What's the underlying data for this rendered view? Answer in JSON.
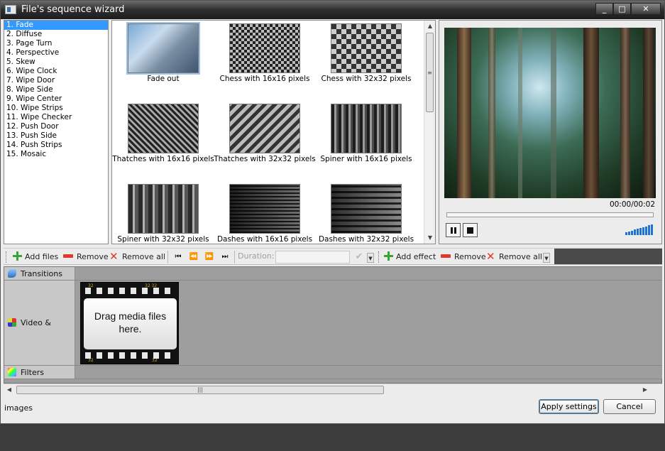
{
  "window": {
    "title": "File's sequence wizard",
    "min_icon": "_",
    "max_icon": "□",
    "close_icon": "✕"
  },
  "effects_list": [
    "1. Fade",
    "2. Diffuse",
    "3. Page Turn",
    "4. Perspective",
    "5. Skew",
    "6. Wipe Clock",
    "7. Wipe Door",
    "8. Wipe Side",
    "9. Wipe Center",
    "10. Wipe Strips",
    "11. Wipe Checker",
    "12. Push Door",
    "13. Push Side",
    "14. Push Strips",
    "15. Mosaic"
  ],
  "thumbnails": [
    "Fade out",
    "Chess with 16x16 pixels",
    "Chess with 32x32 pixels",
    "Thatches with 16x16 pixels",
    "Thatches with 32x32 pixels",
    "Spiner with 16x16 pixels",
    "Spiner with 32x32 pixels",
    "Dashes with 16x16 pixels",
    "Dashes with 32x32 pixels"
  ],
  "preview": {
    "timecode": "00:00/00:02",
    "progress": 0,
    "volume_bars": 10
  },
  "toolbar": {
    "add_files": "Add files",
    "remove": "Remove",
    "remove_all": "Remove all",
    "first": "⏮",
    "prev": "⏪",
    "next": "⏩",
    "last": "⏭",
    "duration_label": "Duration:",
    "duration_value": "",
    "add_effect": "Add effect",
    "remove_effect": "Remove",
    "remove_all_effects": "Remove all"
  },
  "tracks": {
    "transitions": "Transitions",
    "video": "Video & images",
    "filters": "Filters"
  },
  "drop_zone": {
    "line1": "Drag media files",
    "line2": "here."
  },
  "footer": {
    "apply": "Apply settings",
    "cancel": "Cancel"
  },
  "colors": {
    "selection": "#3399ff",
    "accent_green": "#35a635",
    "accent_red": "#e0392b",
    "volume": "#1e73d6"
  }
}
